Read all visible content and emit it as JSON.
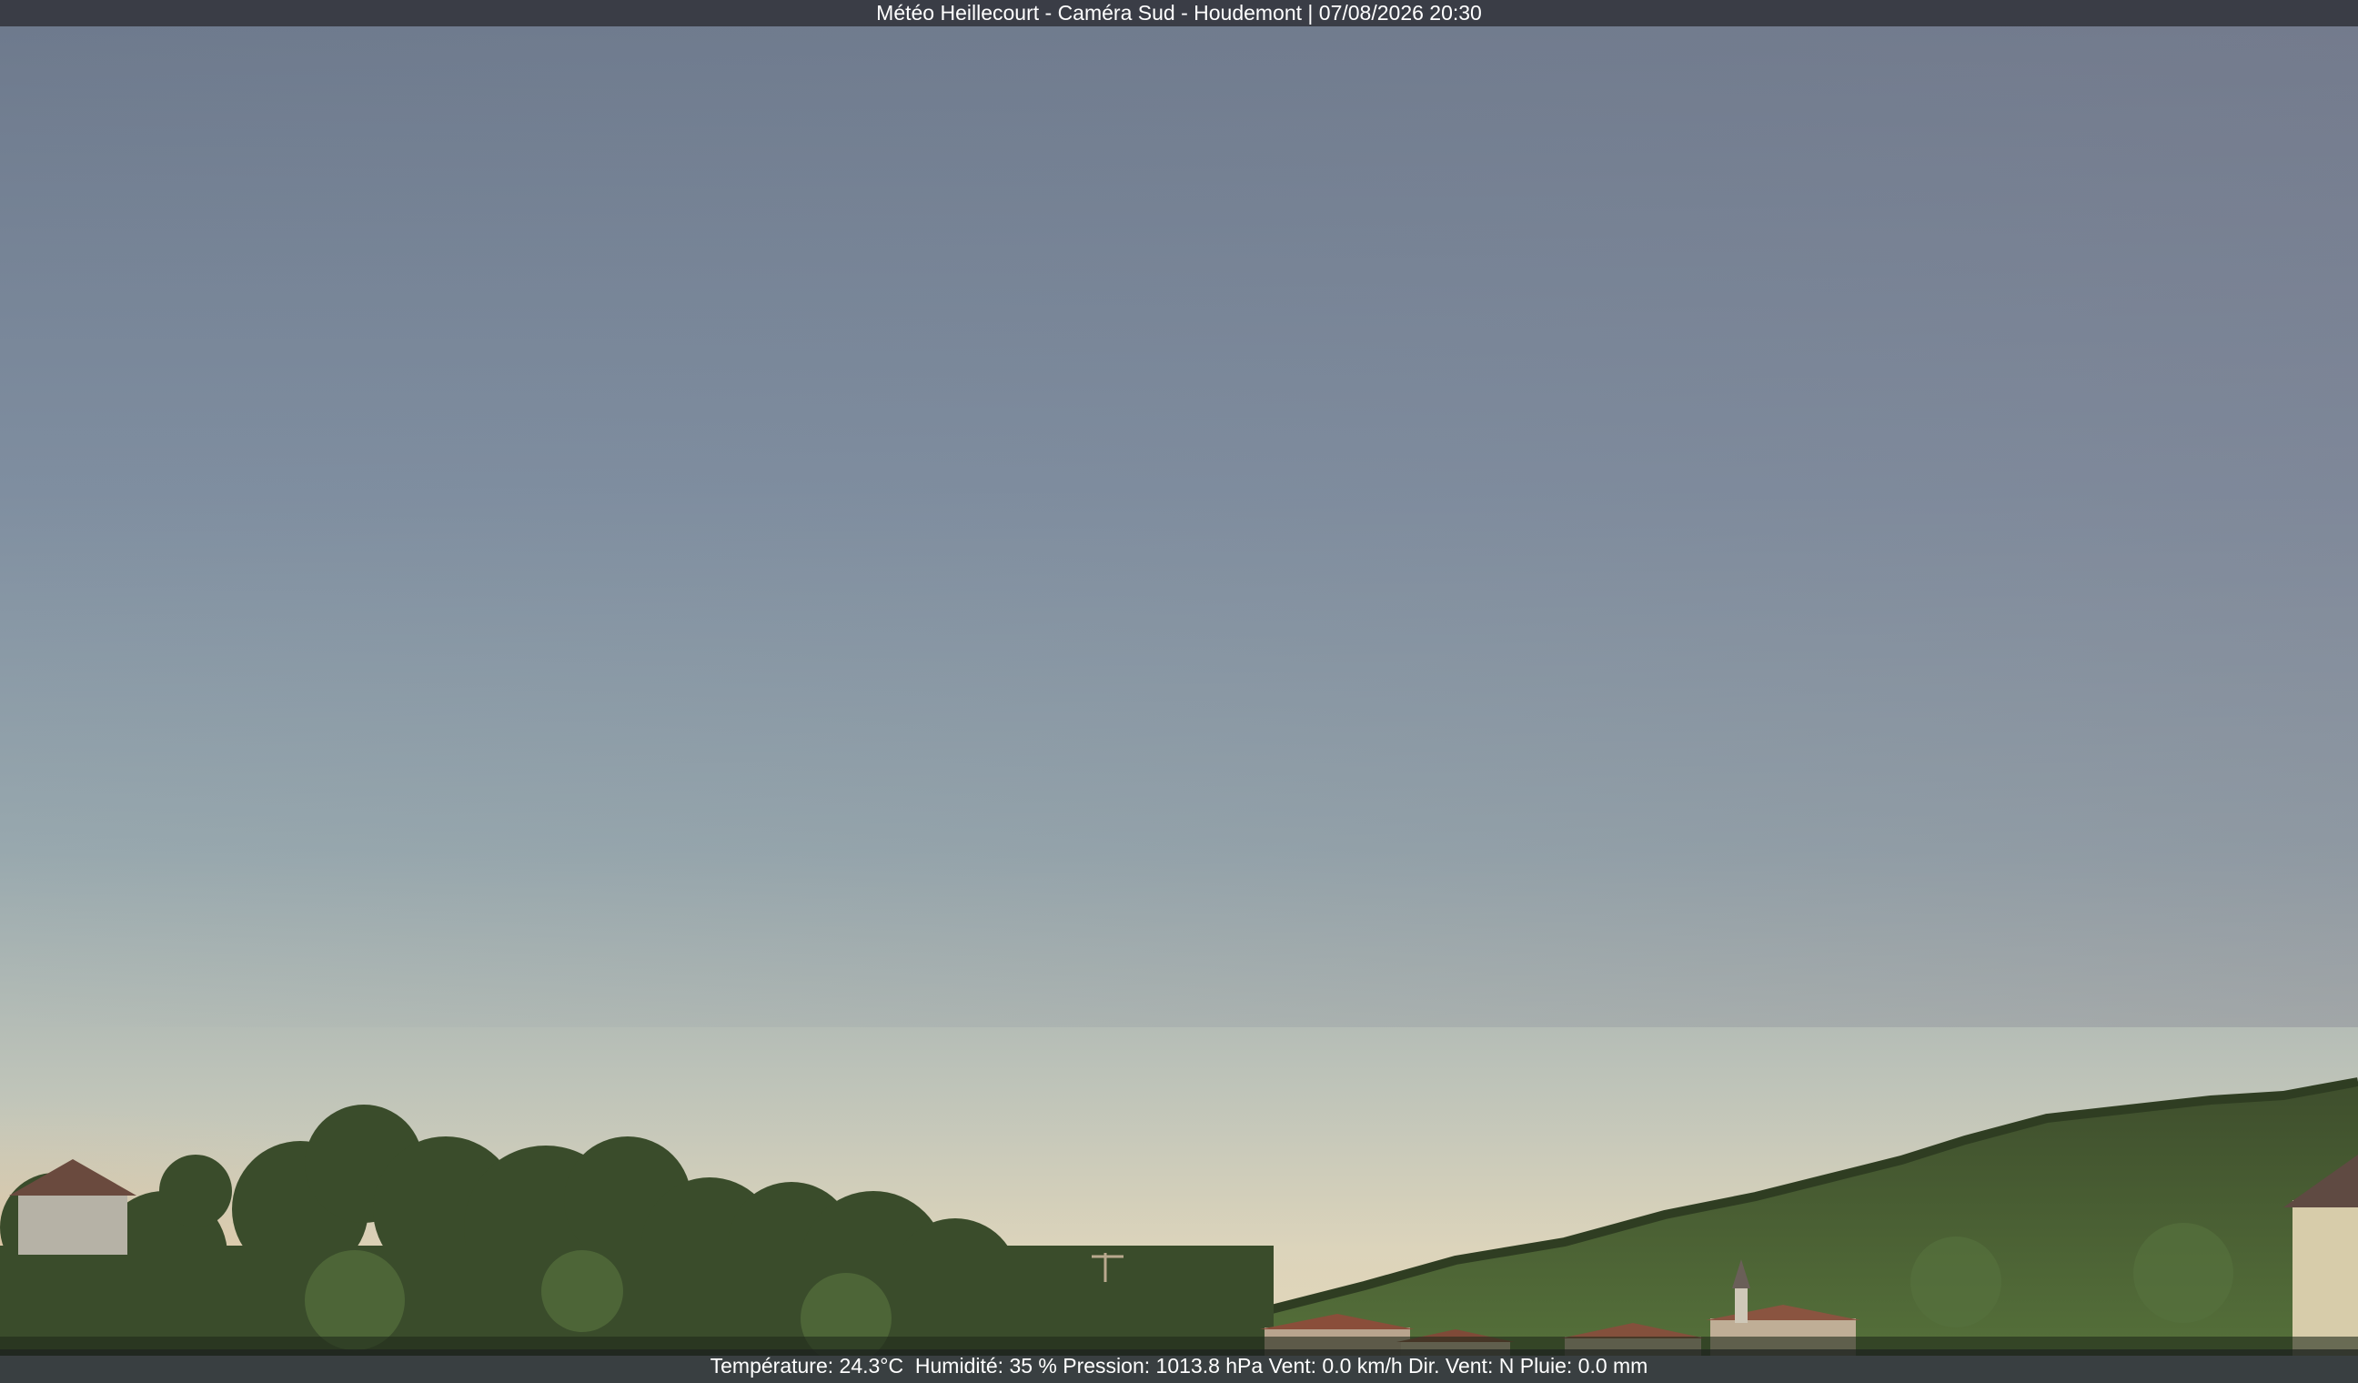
{
  "header": {
    "title": "Météo Heillecourt - Caméra Sud - Houdemont | 07/08/2026 20:30"
  },
  "footer": {
    "temperature": "Température: 24.3°C",
    "humidity": "Humidité: 35 %",
    "pressure": "Pression: 1013.8 hPa",
    "wind": "Vent: 0.0 km/h",
    "wind_dir": "Dir. Vent: N",
    "rain": "Pluie: 0.0 mm"
  },
  "colors": {
    "sky_top": "#6f7b8e",
    "sky_mid": "#8a9ba8",
    "sky_horizon": "#d9d3bf",
    "sunset_glow": "#e0b98c",
    "trees_dark": "#2b3a22",
    "trees_light": "#56703a",
    "roofs": "#8a4e3a"
  }
}
